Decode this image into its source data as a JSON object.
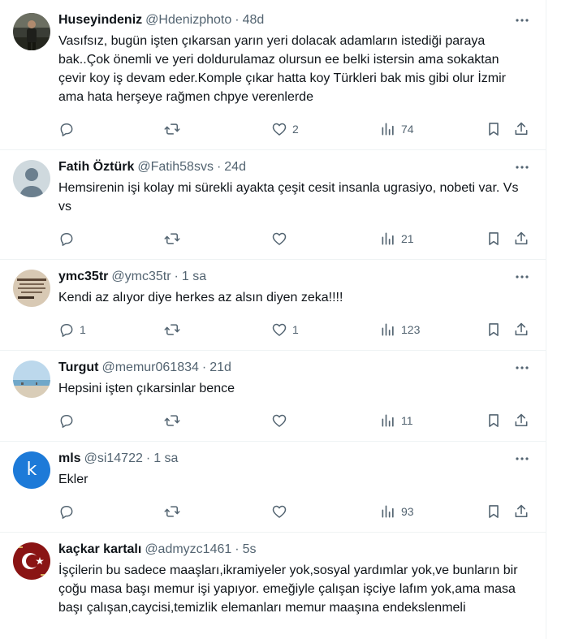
{
  "tweets": [
    {
      "name": "Huseyindeniz",
      "handle": "@Hdenizphoto",
      "dot": "·",
      "time": "48d",
      "text": "Vasıfsız, bugün işten çıkarsan yarın yeri dolacak adamların istediği paraya bak..Çok önemli ve yeri doldurulamaz olursun ee belki istersin ama sokaktan çevir koy iş devam eder.Komple çıkar hatta koy Türkleri bak mis gibi olur İzmir ama hata herşeye rağmen chpye verenlerde",
      "replies": "",
      "likes": "2",
      "views": "74",
      "avatar_icon": "avatar-photo-person"
    },
    {
      "name": "Fatih Öztürk",
      "handle": "@Fatih58svs",
      "dot": "·",
      "time": "24d",
      "text": "Hemsirenin işi kolay mi sürekli ayakta çeşit cesit insanla ugrasiyo, nobeti var. Vs vs",
      "replies": "",
      "likes": "",
      "views": "21",
      "avatar_icon": "default-avatar"
    },
    {
      "name": "ymc35tr",
      "handle": "@ymc35tr",
      "dot": "·",
      "time": "1 sa",
      "text": "Kendi az alıyor diye herkes az alsın diyen zeka!!!!",
      "replies": "1",
      "likes": "1",
      "views": "123",
      "avatar_icon": "avatar-text-image"
    },
    {
      "name": "Turgut",
      "handle": "@memur061834",
      "dot": "·",
      "time": "21d",
      "text": "Hepsini işten çıkarsinlar bence",
      "replies": "",
      "likes": "",
      "views": "11",
      "avatar_icon": "avatar-beach"
    },
    {
      "name": "mls",
      "handle": "@si14722",
      "dot": "·",
      "time": "1 sa",
      "text": "Ekler",
      "replies": "",
      "likes": "",
      "views": "93",
      "avatar_icon": "avatar-letter",
      "avatar_letter": "k",
      "avatar_color": "#1d7ad8"
    },
    {
      "name": "kaçkar kartalı",
      "handle": "@admyzc1461",
      "dot": "·",
      "time": "5s",
      "text": "İşçilerin bu sadece maaşları,ikramiyeler yok,sosyal yardımlar yok,ve bunların bir çoğu masa başı memur işi yapıyor. emeğiyle çalışan işciye lafım yok,ama masa başı çalışan,caycisi,temizlik elemanları memur maaşına endekslenmeli",
      "avatar_icon": "avatar-crescent-star"
    }
  ],
  "colors": {
    "text": "#0f1419",
    "secondary": "#536471",
    "border": "#eff3f4"
  }
}
